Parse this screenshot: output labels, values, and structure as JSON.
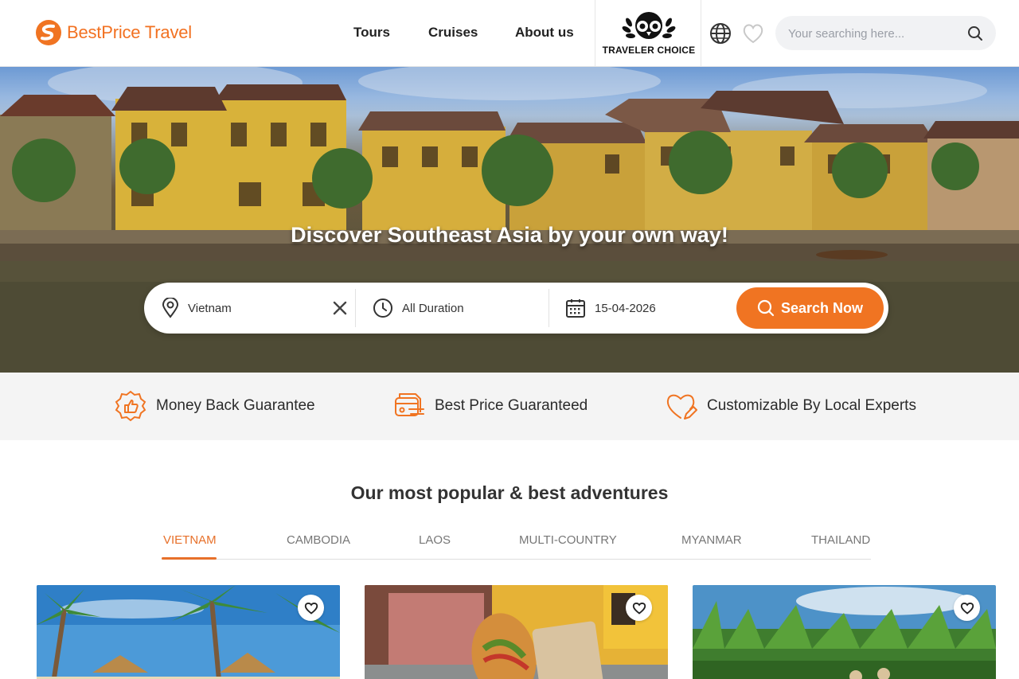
{
  "header": {
    "logo_text": "BestPrice Travel",
    "nav": [
      {
        "label": "Tours"
      },
      {
        "label": "Cruises"
      },
      {
        "label": "About us"
      }
    ],
    "badge_text": "TRAVELER CHOICE",
    "search_placeholder": "Your searching here...",
    "icons": [
      "globe-icon",
      "heart-icon",
      "search-icon"
    ]
  },
  "hero": {
    "title": "Discover Southeast Asia by your own way!",
    "search": {
      "destination": "Vietnam",
      "duration": "All Duration",
      "date": "15-04-2026",
      "button_label": "Search Now"
    }
  },
  "features": [
    {
      "label": "Money Back Guarantee",
      "icon": "thumbs-up-badge-icon"
    },
    {
      "label": "Best Price Guaranteed",
      "icon": "price-tag-icon"
    },
    {
      "label": "Customizable By Local Experts",
      "icon": "heart-edit-icon"
    }
  ],
  "section": {
    "title": "Our most popular & best adventures",
    "tabs": [
      {
        "label": "VIETNAM",
        "active": true
      },
      {
        "label": "CAMBODIA",
        "active": false
      },
      {
        "label": "LAOS",
        "active": false
      },
      {
        "label": "MULTI-COUNTRY",
        "active": false
      },
      {
        "label": "MYANMAR",
        "active": false
      },
      {
        "label": "THAILAND",
        "active": false
      }
    ]
  },
  "colors": {
    "brand_orange": "#f07422",
    "tab_active": "#e7702a",
    "feature_strip_bg": "#f4f4f4",
    "search_bg": "#f1f2f4"
  }
}
